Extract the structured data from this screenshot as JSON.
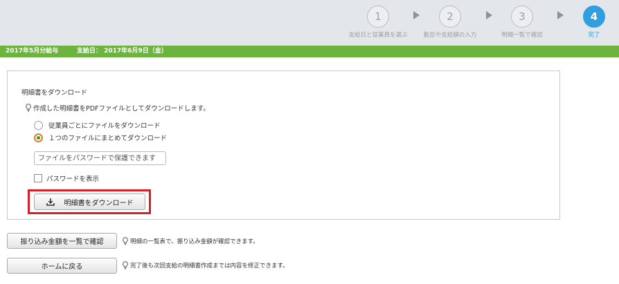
{
  "stepper": {
    "steps": [
      {
        "number": "1",
        "label": "支給日と従業員を選ぶ"
      },
      {
        "number": "2",
        "label": "勤怠や支給額の入力"
      },
      {
        "number": "3",
        "label": "明細一覧で確認"
      },
      {
        "number": "4",
        "label": "完了"
      }
    ],
    "active_step": 4,
    "colors": {
      "active": "#2f9fe0",
      "inactive": "#9aa0a8"
    }
  },
  "infobar": {
    "month": "2017年5月分給与",
    "pay_date": "支給日： 2017年6月9日（金）",
    "color": "#6db33f"
  },
  "download_panel": {
    "title": "明細書をダウンロード",
    "hint": "作成した明細書をPDFファイルとしてダウンロードします。",
    "options": [
      {
        "label": "従業員ごとにファイルをダウンロード",
        "checked": false
      },
      {
        "label": "１つのファイルにまとめてダウンロード",
        "checked": true
      }
    ],
    "password": {
      "placeholder": "ファイルをパスワードで保護できます",
      "value": ""
    },
    "show_password_label": "パスワードを表示",
    "download_button": "明細書をダウンロード",
    "download_icon": "download-icon",
    "highlight_color": "#d61f26"
  },
  "actions": [
    {
      "button": "振り込み金額を一覧で確認",
      "note": "明細の一覧表で、振り込み金額が確認できます。"
    },
    {
      "button": "ホームに戻る",
      "note": "完了後も次回支給の明細書作成までは内容を修正できます。"
    }
  ]
}
